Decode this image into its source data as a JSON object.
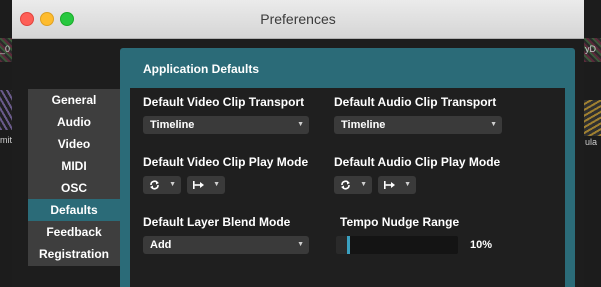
{
  "window": {
    "title": "Preferences"
  },
  "background": {
    "left_text_1": "_0",
    "left_text_2": "mit",
    "right_text_1": "yD",
    "right_text_2": "ula"
  },
  "sidebar": {
    "items": [
      {
        "label": "General",
        "active": false
      },
      {
        "label": "Audio",
        "active": false
      },
      {
        "label": "Video",
        "active": false
      },
      {
        "label": "MIDI",
        "active": false
      },
      {
        "label": "OSC",
        "active": false
      },
      {
        "label": "Defaults",
        "active": true
      },
      {
        "label": "Feedback",
        "active": false
      },
      {
        "label": "Registration",
        "active": false
      }
    ]
  },
  "panel": {
    "title": "Application Defaults",
    "video_transport": {
      "label": "Default Video Clip Transport",
      "value": "Timeline"
    },
    "audio_transport": {
      "label": "Default Audio Clip Transport",
      "value": "Timeline"
    },
    "video_play_mode": {
      "label": "Default Video Clip Play Mode",
      "loop_icon": "loop-icon",
      "direction_icon": "forward-icon"
    },
    "audio_play_mode": {
      "label": "Default Audio Clip Play Mode",
      "loop_icon": "loop-icon",
      "direction_icon": "forward-icon"
    },
    "blend_mode": {
      "label": "Default Layer Blend Mode",
      "value": "Add"
    },
    "tempo_nudge": {
      "label": "Tempo Nudge Range",
      "value_text": "10%",
      "fraction": 0.1
    }
  },
  "colors": {
    "accent": "#2b6b78",
    "slider_handle": "#3aa0c0"
  }
}
